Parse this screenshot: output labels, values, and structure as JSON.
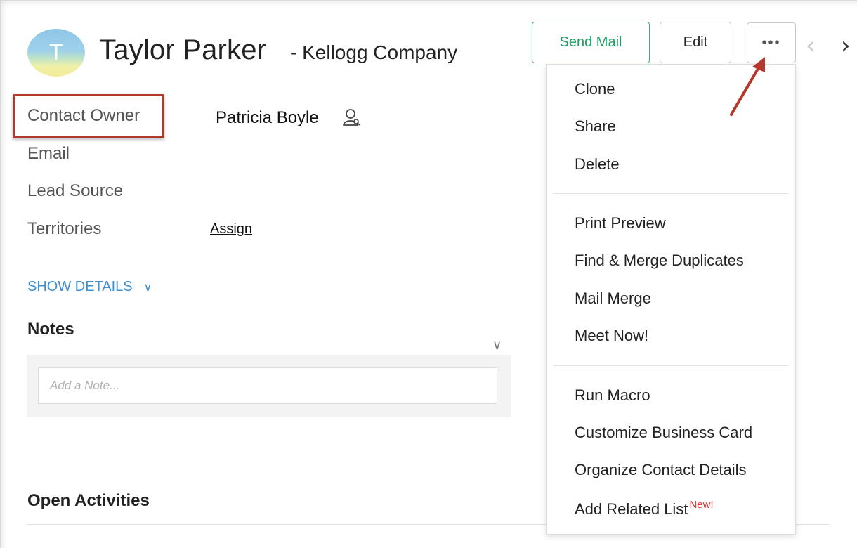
{
  "header": {
    "avatar_letter": "T",
    "name": "Taylor Parker",
    "company": "- Kellogg Company",
    "send_mail_label": "Send Mail",
    "edit_label": "Edit",
    "more_label": "•••",
    "prev_arrow": "‹",
    "next_arrow": "›"
  },
  "fields": {
    "contact_owner_label": "Contact Owner",
    "contact_owner_value": "Patricia Boyle",
    "email_label": "Email",
    "lead_source_label": "Lead Source",
    "territories_label": "Territories",
    "territories_link": "Assign"
  },
  "show_details": {
    "label": "SHOW DETAILS",
    "chevron": "∨"
  },
  "notes": {
    "title": "Notes",
    "placeholder": "Add a Note...",
    "chevron": "∨"
  },
  "open_activities": {
    "title": "Open Activities"
  },
  "menu": {
    "group1": [
      "Clone",
      "Share",
      "Delete"
    ],
    "group2": [
      "Print Preview",
      "Find & Merge Duplicates",
      "Mail Merge",
      "Meet Now!"
    ],
    "group3": [
      "Run Macro",
      "Customize Business Card",
      "Organize Contact Details",
      "Add Related List"
    ],
    "new_badge": "New!"
  },
  "colors": {
    "accent_green": "#1f9d62",
    "link_blue": "#3d8fd1",
    "highlight_red": "#b4382c",
    "badge_red": "#e53935"
  }
}
